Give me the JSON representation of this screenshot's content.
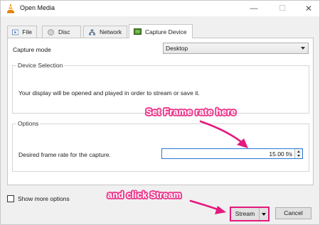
{
  "window": {
    "title": "Open Media",
    "app_icon": "vlc-cone-icon"
  },
  "tabs": [
    {
      "label": "File",
      "icon": "file-icon"
    },
    {
      "label": "Disc",
      "icon": "disc-icon"
    },
    {
      "label": "Network",
      "icon": "network-icon"
    },
    {
      "label": "Capture Device",
      "icon": "capture-device-icon",
      "active": true
    }
  ],
  "capture": {
    "mode_label": "Capture mode",
    "mode_value": "Desktop"
  },
  "device_selection": {
    "title": "Device Selection",
    "text": "Your display will be opened and played in order to stream or save it."
  },
  "options": {
    "title": "Options",
    "frame_rate_label": "Desired frame rate for the capture.",
    "frame_rate_value": "15.00 f/s"
  },
  "footer": {
    "show_more_label": "Show more options",
    "stream_label": "Stream",
    "cancel_label": "Cancel"
  },
  "annotations": {
    "frame_rate": "Set Frame rate here",
    "stream": "and click Stream",
    "color": "#e5197e"
  }
}
